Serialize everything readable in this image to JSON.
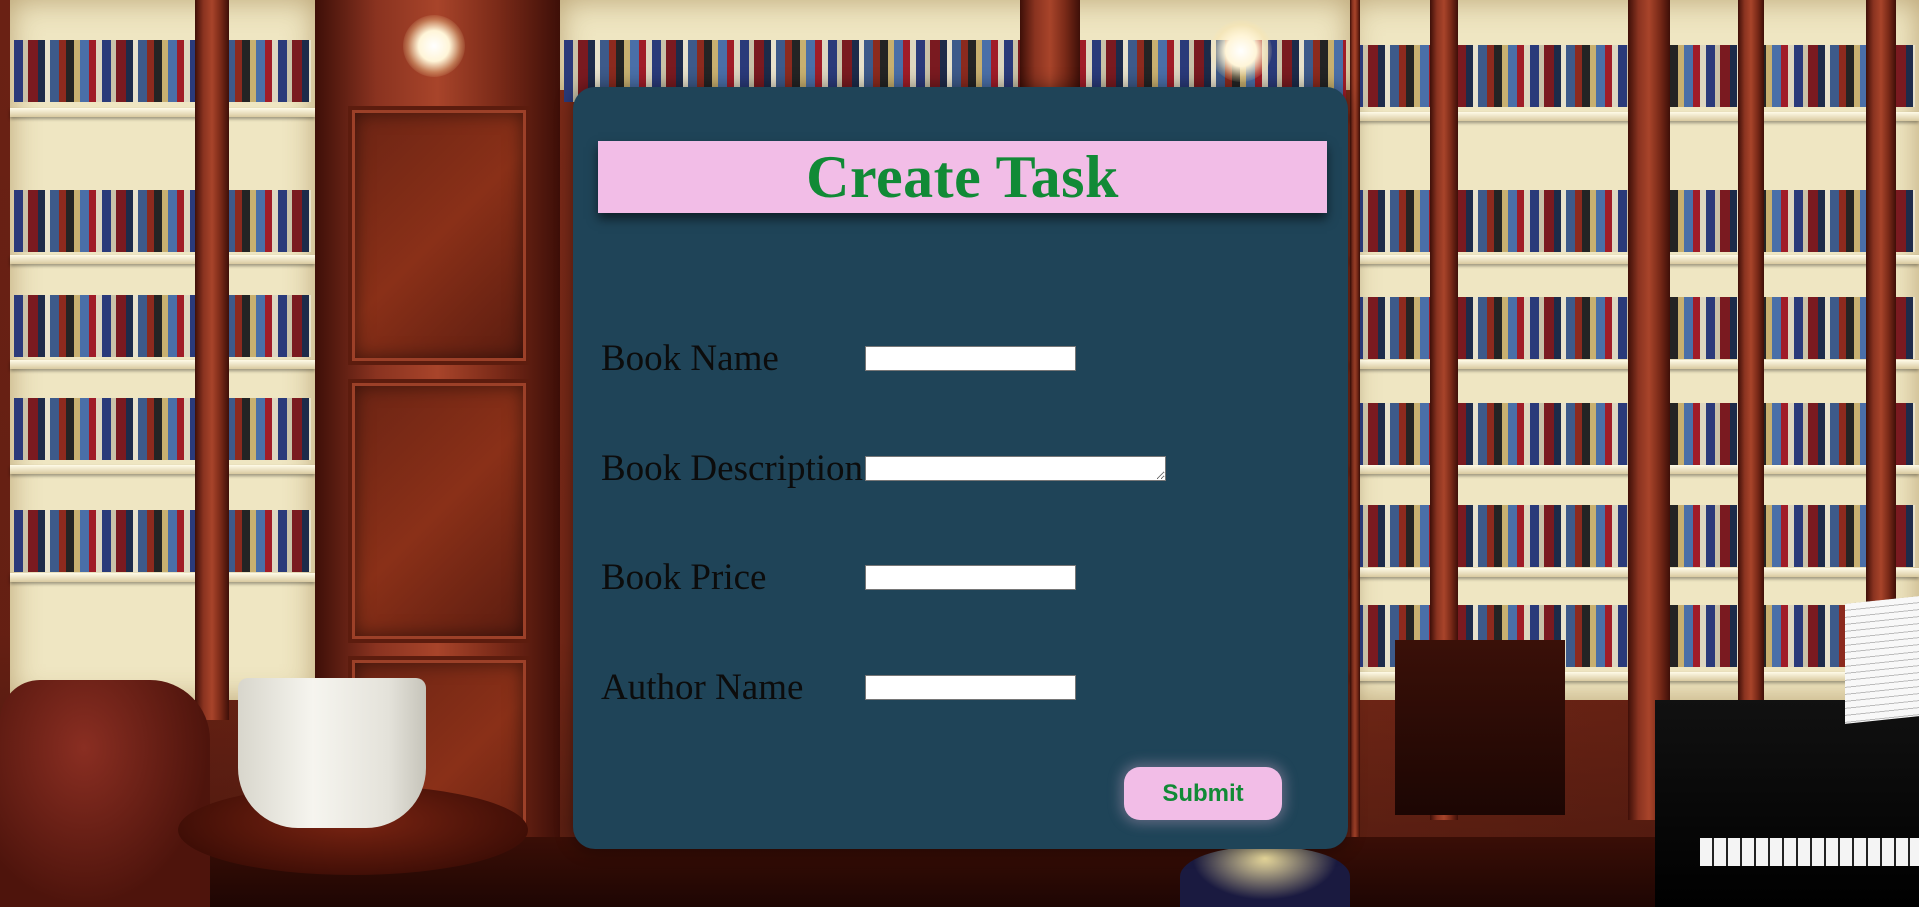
{
  "page": {
    "background_scene": "library-bookshelves-photo"
  },
  "form": {
    "title": "Create Task",
    "fields": [
      {
        "label": "Book Name",
        "type": "text",
        "value": ""
      },
      {
        "label": "Book Description",
        "type": "textarea",
        "value": ""
      },
      {
        "label": "Book Price",
        "type": "text",
        "value": ""
      },
      {
        "label": "Author Name",
        "type": "text",
        "value": ""
      }
    ],
    "submit_label": "Submit"
  },
  "colors": {
    "card_background": "#1f4458",
    "title_bar_background": "#f2bde7",
    "title_text": "#118a36",
    "button_background": "#f2bde7",
    "button_text": "#118a36",
    "label_text": "#0c0c0c"
  }
}
